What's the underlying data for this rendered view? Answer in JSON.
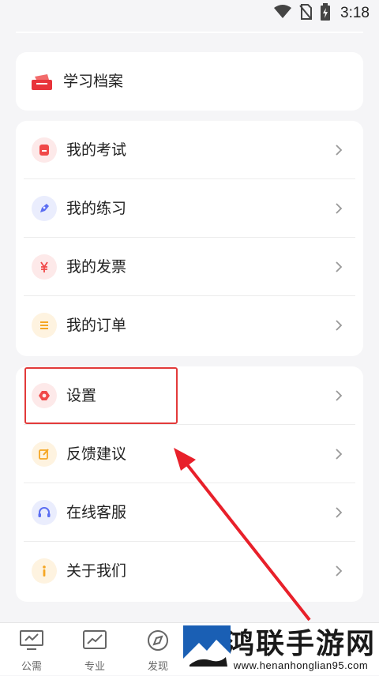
{
  "status_bar": {
    "time": "3:18"
  },
  "archive": {
    "label": "学习档案"
  },
  "menu_group_1": [
    {
      "label": "我的考试",
      "icon": "exam-icon",
      "color": "#f04848",
      "bg": "#fde9e9"
    },
    {
      "label": "我的练习",
      "icon": "pen-icon",
      "color": "#5b6ef2",
      "bg": "#eaedfd"
    },
    {
      "label": "我的发票",
      "icon": "yuan-icon",
      "color": "#f04848",
      "bg": "#fde9e9"
    },
    {
      "label": "我的订单",
      "icon": "list-icon",
      "color": "#f5a623",
      "bg": "#fef3e0"
    }
  ],
  "menu_group_2": [
    {
      "label": "设置",
      "icon": "settings-icon",
      "color": "#f04848",
      "bg": "#fde9e9"
    },
    {
      "label": "反馈建议",
      "icon": "edit-icon",
      "color": "#f5a623",
      "bg": "#fef3e0"
    },
    {
      "label": "在线客服",
      "icon": "headset-icon",
      "color": "#5b6ef2",
      "bg": "#eaedfd"
    },
    {
      "label": "关于我们",
      "icon": "info-icon",
      "color": "#f5a623",
      "bg": "#fef3e0"
    }
  ],
  "tabs": [
    {
      "label": "公需",
      "icon": "monitor-icon"
    },
    {
      "label": "专业",
      "icon": "chart-icon"
    },
    {
      "label": "发现",
      "icon": "compass-icon"
    }
  ],
  "watermark": {
    "brand": "鸿联手游网",
    "url": "www.henanhonglian95.com"
  },
  "annotation": {
    "highlight_color": "#e23a3a"
  }
}
